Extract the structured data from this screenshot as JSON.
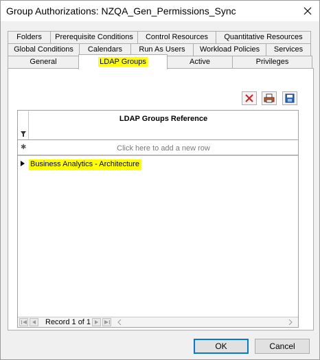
{
  "window": {
    "title": "Group Authorizations: NZQA_Gen_Permissions_Sync"
  },
  "tabs": {
    "row1": [
      "Folders",
      "Prerequisite Conditions",
      "Control Resources",
      "Quantitative Resources"
    ],
    "row2": [
      "Global Conditions",
      "Calendars",
      "Run As Users",
      "Workload Policies",
      "Services"
    ],
    "row3": [
      "General",
      "LDAP Groups",
      "Active",
      "Privileges"
    ],
    "active": "LDAP Groups"
  },
  "toolbar": {
    "icons": [
      "delete-icon",
      "print-icon",
      "save-icon"
    ]
  },
  "grid": {
    "column_header": "LDAP Groups Reference",
    "new_row_prompt": "Click here to add a new row",
    "rows": [
      {
        "value": "Business Analytics - Architecture"
      }
    ],
    "record_status": "Record 1 of 1"
  },
  "buttons": {
    "ok": "OK",
    "cancel": "Cancel"
  },
  "colors": {
    "highlight": "#ffff00",
    "default_button_border": "#0078d7"
  }
}
